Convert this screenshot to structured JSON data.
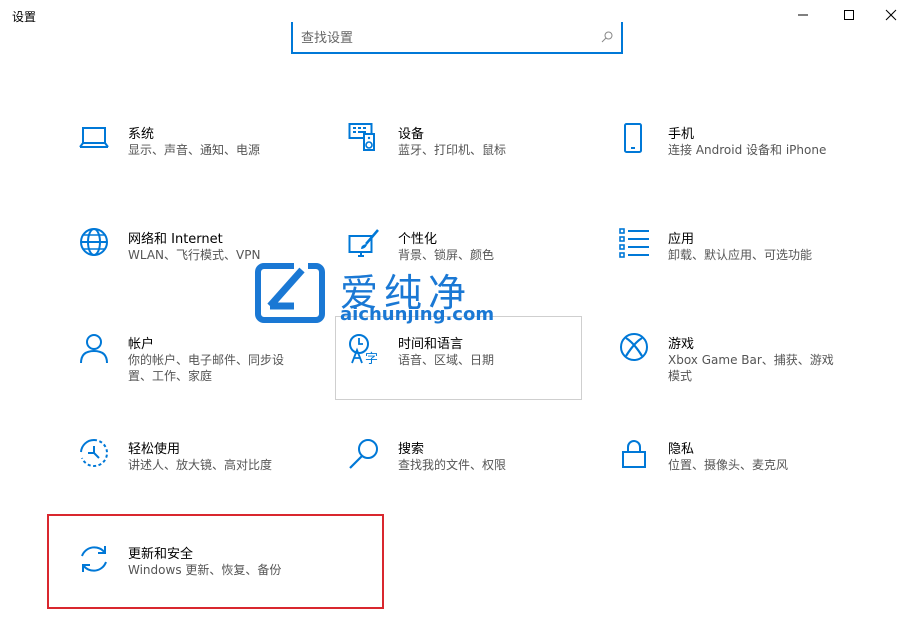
{
  "window": {
    "title": "设置",
    "controls": [
      "minimize-icon",
      "maximize-icon",
      "close-icon"
    ]
  },
  "search": {
    "placeholder": "查找设置",
    "value": ""
  },
  "tiles": [
    {
      "title": "系统",
      "desc": "显示、声音、通知、电源",
      "icon": "laptop-icon"
    },
    {
      "title": "设备",
      "desc": "蓝牙、打印机、鼠标",
      "icon": "keyboard-speaker-icon"
    },
    {
      "title": "手机",
      "desc": "连接 Android 设备和 iPhone",
      "icon": "phone-icon"
    },
    {
      "title": "网络和 Internet",
      "desc": "WLAN、飞行模式、VPN",
      "icon": "globe-icon"
    },
    {
      "title": "个性化",
      "desc": "背景、锁屏、颜色",
      "icon": "paint-brush-icon"
    },
    {
      "title": "应用",
      "desc": "卸载、默认应用、可选功能",
      "icon": "app-list-icon"
    },
    {
      "title": "帐户",
      "desc": "你的帐户、电子邮件、同步设置、工作、家庭",
      "icon": "person-icon"
    },
    {
      "title": "时间和语言",
      "desc": "语音、区域、日期",
      "icon": "time-language-icon"
    },
    {
      "title": "游戏",
      "desc": "Xbox Game Bar、捕获、游戏模式",
      "icon": "xbox-icon"
    },
    {
      "title": "轻松使用",
      "desc": "讲述人、放大镜、高对比度",
      "icon": "ease-of-access-icon"
    },
    {
      "title": "搜索",
      "desc": "查找我的文件、权限",
      "icon": "search-icon"
    },
    {
      "title": "隐私",
      "desc": "位置、摄像头、麦克风",
      "icon": "lock-icon"
    },
    {
      "title": "更新和安全",
      "desc": "Windows 更新、恢复、备份",
      "icon": "sync-icon"
    }
  ],
  "watermark": {
    "brand": "爱纯净",
    "url": "aichunjing.com"
  },
  "colors": {
    "accent": "#0078d7",
    "highlight": "#d9272e"
  }
}
